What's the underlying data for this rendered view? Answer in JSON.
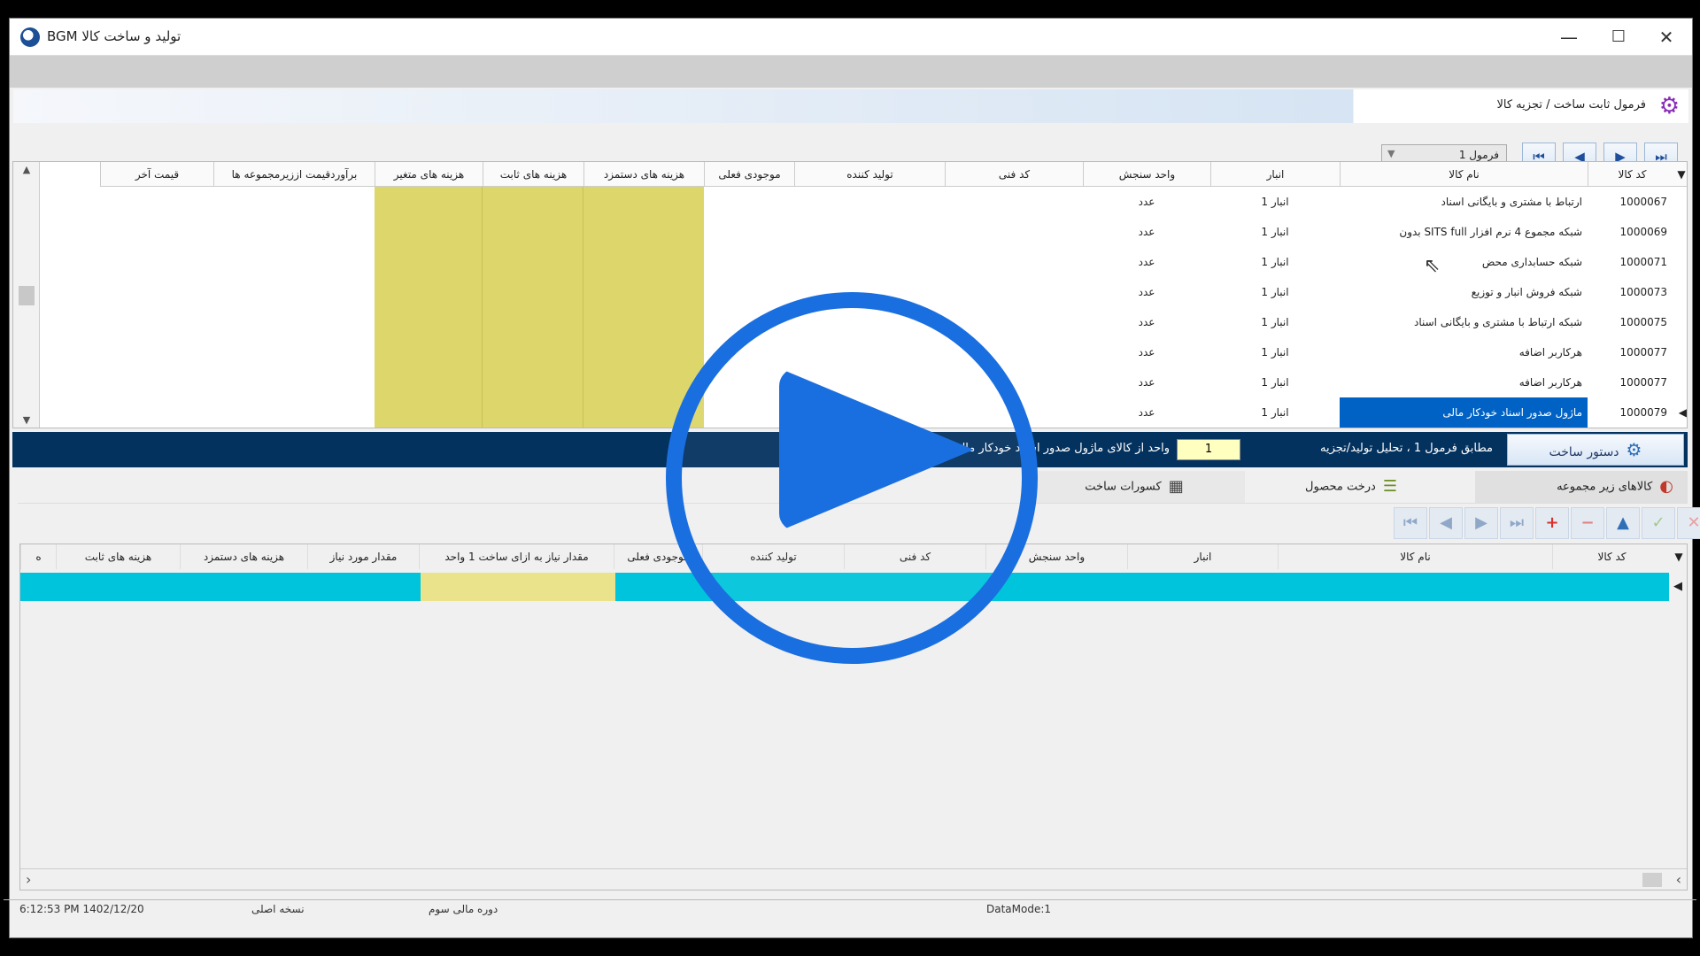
{
  "window": {
    "title": "تولید و ساخت کالا BGM",
    "minimize": "—",
    "maximize": "☐",
    "close": "✕"
  },
  "form_header": {
    "title": "فرمول ثابت ساخت / تجزیه کالا",
    "icon": "gear-icon"
  },
  "formula_select": {
    "value": "فرمول 1"
  },
  "nav": {
    "first": "⏮",
    "prev": "◀",
    "next": "▶",
    "last": "⏭"
  },
  "grid1": {
    "columns": [
      "کد کالا",
      "نام کالا",
      "انبار",
      "واحد سنجش",
      "کد فنی",
      "تولید کننده",
      "موجودی فعلی",
      "هزینه های دستمزد",
      "هزینه های ثابت",
      "هزینه های متغیر",
      "برآوردقیمت اززیرمجموعه ها",
      "قیمت آخر"
    ],
    "rows": [
      {
        "code": "1000067",
        "name": "ارتباط با مشتری و بایگانی اسناد",
        "warehouse": "انبار 1",
        "unit": "عدد"
      },
      {
        "code": "1000069",
        "name": "شبکه مجموع 4 نرم افزار SITS full بدون",
        "warehouse": "انبار 1",
        "unit": "عدد"
      },
      {
        "code": "1000071",
        "name": "شبکه حسابداری محض",
        "warehouse": "انبار 1",
        "unit": "عدد"
      },
      {
        "code": "1000073",
        "name": "شبکه فروش انبار و توزیع",
        "warehouse": "انبار 1",
        "unit": "عدد"
      },
      {
        "code": "1000075",
        "name": "شبکه ارتباط با مشتری و بایگانی اسناد",
        "warehouse": "انبار 1",
        "unit": "عدد"
      },
      {
        "code": "1000077",
        "name": "هرکاربر اضافه",
        "warehouse": "انبار 1",
        "unit": "عدد"
      },
      {
        "code": "1000077",
        "name": "هرکاربر اضافه",
        "warehouse": "انبار 1",
        "unit": "عدد"
      },
      {
        "code": "1000079",
        "name": "ماژول صدور اسناد خودکار مالی",
        "warehouse": "انبار 1",
        "unit": "عدد"
      }
    ]
  },
  "build_bar": {
    "button_label": "دستور ساخت",
    "msg_prefix": "مطابق فرمول 1 ، تحلیل تولید/تجزیه",
    "qty": "1",
    "msg_suffix": "واحد از کالای ماژول صدور اسناد خودکار مالی"
  },
  "tabs": [
    "کالاهای زیر مجموعه",
    "درخت محصول",
    "کسورات ساخت"
  ],
  "toolbar2": [
    "⏮",
    "◀",
    "▶",
    "⏭",
    "+",
    "−",
    "▲",
    "✓",
    "✕",
    "↻"
  ],
  "grid2": {
    "columns": [
      "کد کالا",
      "نام کالا",
      "انبار",
      "واحد سنجش",
      "کد فنی",
      "تولید کننده",
      "موجودی فعلی",
      "مقدار نیاز به ازای ساخت 1 واحد",
      "مقدار مورد نیاز",
      "هزینه های دستمزد",
      "هزینه های ثابت",
      "ه"
    ]
  },
  "statusbar": {
    "datetime": "6:12:53 PM 1402/12/20",
    "version": "نسخه اصلی",
    "period": "دوره مالی سوم",
    "db": "DataMode:1"
  },
  "colors": {
    "accent": "#04325f",
    "highlight": "#ddd66b",
    "cyan": "#00c4dc",
    "selection": "#0062c4"
  }
}
